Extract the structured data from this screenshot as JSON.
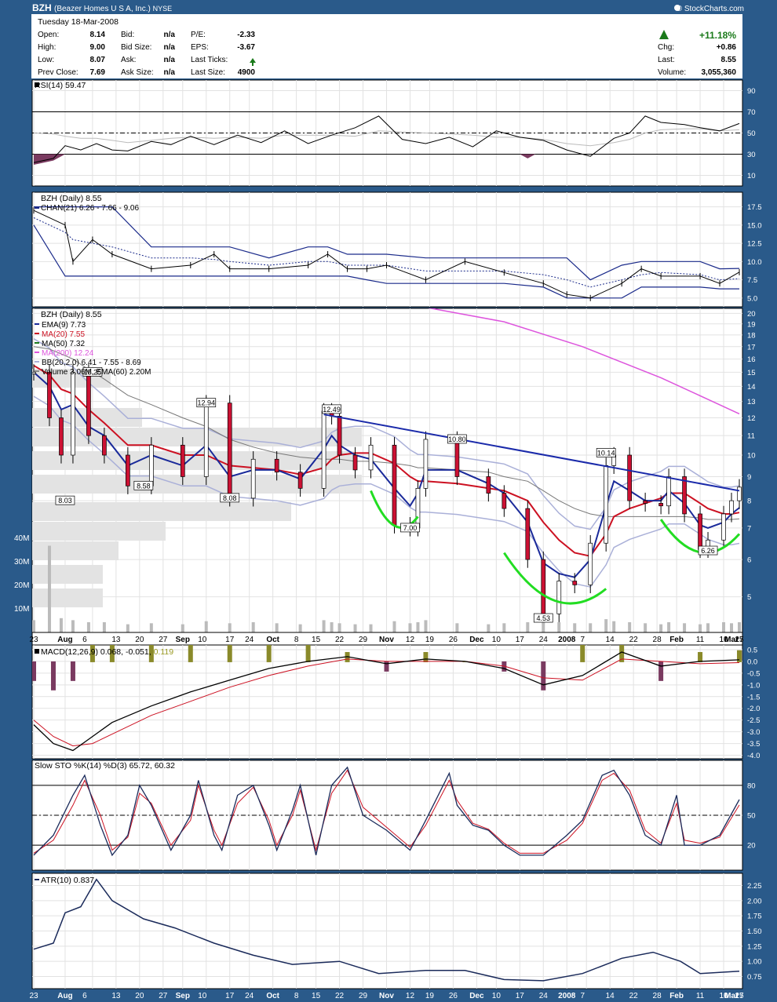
{
  "header": {
    "symbol": "BZH",
    "company": "(Beazer Homes U S A, Inc.)",
    "exchange": "NYSE",
    "credit": "© StockCharts.com",
    "date": "Tuesday  18-Mar-2008",
    "fields_left": [
      {
        "label": "Open:",
        "value": "8.14"
      },
      {
        "label": "High:",
        "value": "9.00"
      },
      {
        "label": "Low:",
        "value": "8.07"
      },
      {
        "label": "Prev Close:",
        "value": "7.69"
      }
    ],
    "fields_mid": [
      {
        "label": "Bid:",
        "value": "n/a"
      },
      {
        "label": "Bid Size:",
        "value": "n/a"
      },
      {
        "label": "Ask:",
        "value": "n/a"
      },
      {
        "label": "Ask Size:",
        "value": "n/a"
      }
    ],
    "fields_pe": [
      {
        "label": "P/E:",
        "value": "-2.33"
      },
      {
        "label": "EPS:",
        "value": "-3.67"
      },
      {
        "label": "Last Ticks:",
        "value": ""
      },
      {
        "label": "Last Size:",
        "value": "4900"
      }
    ],
    "change_pct": "+11.18%",
    "fields_right": [
      {
        "label": "Chg:",
        "value": "+0.86"
      },
      {
        "label": "Last:",
        "value": "8.55"
      },
      {
        "label": "Volume:",
        "value": "3,055,360"
      }
    ]
  },
  "colors": {
    "up": "#1a7a1a",
    "candle_down": "#cc1133",
    "ema9": "#1a2a9a",
    "ma20": "#cc1122",
    "ma50": "#1a7a1a",
    "ma200": "#dd55dd",
    "band": "#aab0d8",
    "trend": "#1a2aaa",
    "cup": "#22dd22",
    "volume": "#bbbbbb"
  },
  "chart_data": [
    {
      "panel": "rsi",
      "type": "line",
      "title": "RSI(14) 59.47",
      "yticks": [
        10,
        30,
        50,
        70,
        90
      ],
      "ylim": [
        0,
        100
      ],
      "x": [
        0,
        5,
        8,
        12,
        16,
        20,
        24,
        30,
        35,
        40,
        46,
        52,
        58,
        64,
        70,
        76,
        82,
        88,
        94,
        100,
        106,
        112,
        118,
        124,
        130,
        136,
        142,
        148,
        152,
        156,
        160,
        166,
        170,
        175,
        180
      ],
      "values": [
        22,
        26,
        38,
        34,
        40,
        34,
        33,
        42,
        39,
        47,
        39,
        48,
        41,
        52,
        40,
        48,
        55,
        66,
        44,
        40,
        46,
        37,
        52,
        46,
        43,
        34,
        28,
        45,
        50,
        66,
        60,
        58,
        55,
        52,
        59
      ],
      "secondary_values": [
        50,
        49,
        47,
        45,
        45,
        43,
        41,
        43,
        45,
        46,
        45,
        46,
        45,
        48,
        48,
        48,
        47,
        52,
        51,
        50,
        49,
        48,
        46,
        46,
        44,
        40,
        38,
        41,
        44,
        50,
        53,
        54,
        54,
        52,
        53
      ]
    },
    {
      "panel": "channel",
      "type": "line",
      "title": "BZH (Daily) 8.55",
      "legend": [
        "CHAN(21) 6.26 - 7.66 - 9.06"
      ],
      "yticks": [
        5.0,
        7.5,
        10.0,
        12.5,
        15.0,
        17.5
      ],
      "ylim": [
        3.8,
        19.5
      ],
      "x": [
        0,
        8,
        10,
        15,
        20,
        30,
        40,
        46,
        50,
        60,
        70,
        75,
        80,
        85,
        90,
        100,
        110,
        120,
        130,
        136,
        142,
        150,
        155,
        160,
        170,
        175,
        180
      ],
      "values": [
        17,
        15,
        10,
        13,
        11,
        9,
        9.5,
        11,
        9,
        9,
        9.5,
        11,
        9,
        9,
        9.5,
        7.5,
        10,
        8.5,
        7,
        5.5,
        5,
        7,
        9,
        8,
        8,
        7,
        8.55
      ],
      "upper": [
        17.5,
        17.5,
        17.5,
        17.5,
        17.5,
        12,
        12,
        12,
        12,
        10.5,
        12,
        12,
        11,
        11,
        11,
        10.5,
        10.5,
        10.5,
        10.5,
        10.5,
        7.5,
        9.5,
        10,
        10,
        10,
        9,
        9.06
      ],
      "middle": [
        16,
        14,
        13,
        12.5,
        12,
        10.5,
        10.5,
        10.3,
        10,
        9.5,
        10,
        10,
        9.5,
        9.5,
        9.5,
        8.7,
        8.7,
        8.7,
        8.2,
        7.5,
        6.5,
        7.5,
        8.2,
        8.5,
        8.2,
        7.5,
        7.66
      ],
      "lower": [
        15,
        8,
        8,
        8,
        8,
        8,
        8,
        8,
        8,
        8,
        8,
        8,
        8,
        7.5,
        7,
        7,
        7,
        7,
        6.5,
        5,
        5,
        5,
        6.5,
        6.5,
        6.5,
        6.26,
        6.26
      ]
    },
    {
      "panel": "price",
      "type": "line",
      "title": "BZH (Daily) 8.55",
      "legend": [
        "EMA(9) 7.73",
        "MA(20) 7.55",
        "MA(50) 7.32",
        "MA(200) 12.24",
        "BB(20,2.0) 6.41 - 7.55 - 8.69",
        "Volume 3.06M, EMA(60) 2.20M"
      ],
      "yticks": [
        5,
        6,
        7,
        8,
        9,
        10,
        11,
        12,
        13,
        14,
        15,
        16,
        17,
        18,
        19,
        20
      ],
      "vol_ticks": [
        "10M",
        "20M",
        "30M",
        "40M"
      ],
      "ylim": [
        4.2,
        20.5
      ],
      "x": [
        0,
        4,
        7,
        10,
        14,
        18,
        24,
        30,
        38,
        44,
        50,
        56,
        62,
        68,
        74,
        76,
        78,
        82,
        86,
        92,
        96,
        98,
        100,
        108,
        116,
        120,
        126,
        130,
        134,
        138,
        142,
        146,
        148,
        152,
        156,
        160,
        162,
        166,
        170,
        172,
        176,
        178,
        180
      ],
      "values": [
        15,
        12,
        10,
        15,
        11,
        10,
        8.6,
        10.5,
        9,
        12.9,
        8.1,
        9.8,
        9.2,
        8.5,
        12.4,
        12.1,
        10,
        9.3,
        10.5,
        7.1,
        7,
        8.5,
        10.8,
        9,
        8.3,
        7.7,
        6,
        4.6,
        5.4,
        5.3,
        6.5,
        9.5,
        10,
        8,
        7.9,
        7.8,
        9,
        7.5,
        6.3,
        6.6,
        7.5,
        8,
        8.55
      ],
      "ema9": [
        15,
        14,
        12.5,
        12.8,
        11.5,
        11,
        9.5,
        10,
        9.5,
        10.5,
        9,
        9.3,
        9.3,
        8.9,
        10.3,
        11,
        10.5,
        10,
        9.8,
        8.5,
        7.8,
        8.3,
        9.3,
        9.3,
        8.7,
        8.3,
        7.2,
        5.9,
        5.6,
        5.5,
        6.0,
        7.8,
        8.8,
        8.4,
        8.0,
        8.0,
        8.4,
        7.9,
        7.1,
        7.0,
        7.2,
        7.5,
        7.73
      ],
      "ma20": [
        15.5,
        14.8,
        13.8,
        13.5,
        12.5,
        11.7,
        10.5,
        10.5,
        10,
        10,
        9.5,
        9.4,
        9.3,
        9.1,
        9.4,
        9.8,
        10,
        10.1,
        10.1,
        9.6,
        9.0,
        8.8,
        8.8,
        8.7,
        8.5,
        8.4,
        8.0,
        7.2,
        6.6,
        6.2,
        6.1,
        6.8,
        7.4,
        7.7,
        7.9,
        8.1,
        8.3,
        8.3,
        7.9,
        7.7,
        7.5,
        7.5,
        7.55
      ],
      "ma50": [
        17,
        16.8,
        16.4,
        16,
        15.2,
        14.5,
        13.4,
        12.8,
        12,
        11.5,
        10.8,
        10.4,
        10.1,
        9.9,
        9.8,
        9.8,
        9.8,
        9.7,
        9.7,
        9.6,
        9.5,
        9.4,
        9.4,
        9.3,
        9.2,
        9.0,
        8.8,
        8.4,
        8.0,
        7.7,
        7.5,
        7.4,
        7.4,
        7.4,
        7.4,
        7.4,
        7.4,
        7.4,
        7.35,
        7.3,
        7.3,
        7.3,
        7.32
      ],
      "ma200_x": [
        100,
        120,
        140,
        160,
        180
      ],
      "ma200": [
        20.6,
        19.2,
        17,
        14.6,
        12.24
      ],
      "volume_pct": [
        12,
        85,
        14,
        12,
        10,
        10,
        8,
        9,
        8,
        11,
        9,
        10,
        9,
        8,
        12,
        10,
        9,
        8,
        8,
        11,
        9,
        10,
        12,
        9,
        8,
        9,
        10,
        11,
        10,
        9,
        9,
        13,
        11,
        10,
        9,
        8,
        10,
        9,
        8,
        9,
        10,
        9,
        10
      ],
      "annotations": [
        {
          "x": 15,
          "y": 15,
          "label": "15.25"
        },
        {
          "x": 8,
          "y": 8,
          "label": "8.03"
        },
        {
          "x": 28,
          "y": 8.6,
          "label": "8.58"
        },
        {
          "x": 44,
          "y": 12.9,
          "label": "12.94"
        },
        {
          "x": 50,
          "y": 8.1,
          "label": "8.08"
        },
        {
          "x": 76,
          "y": 12.5,
          "label": "12.49"
        },
        {
          "x": 96,
          "y": 7,
          "label": "7.00"
        },
        {
          "x": 108,
          "y": 10.8,
          "label": "10.80"
        },
        {
          "x": 130,
          "y": 4.5,
          "label": "4.53"
        },
        {
          "x": 146,
          "y": 10.1,
          "label": "10.14"
        },
        {
          "x": 172,
          "y": 6.26,
          "label": "6.26"
        }
      ],
      "trendline": {
        "x": [
          74,
          180
        ],
        "y": [
          12.2,
          8.4
        ]
      }
    },
    {
      "panel": "macd",
      "type": "line",
      "title_main": "MACD(12,26,9) 0.068, -0.051,",
      "title_hist": "0.119",
      "yticks": [
        0.5,
        0.0,
        -0.5,
        -1.0,
        -1.5,
        -2.0,
        -2.5,
        -3.0,
        -3.5,
        -4.0
      ],
      "ylim": [
        -4.15,
        0.7
      ],
      "x": [
        0,
        5,
        10,
        15,
        20,
        30,
        40,
        50,
        60,
        70,
        80,
        90,
        100,
        110,
        120,
        130,
        140,
        150,
        160,
        170,
        180
      ],
      "values": [
        -2.7,
        -3.5,
        -3.8,
        -3.2,
        -2.6,
        -1.9,
        -1.3,
        -0.8,
        -0.3,
        0.0,
        0.2,
        -0.1,
        0.1,
        0.0,
        -0.3,
        -1.0,
        -0.6,
        0.4,
        -0.2,
        0.0,
        0.068
      ],
      "signal": [
        -2.5,
        -3.2,
        -3.6,
        -3.5,
        -3.1,
        -2.3,
        -1.7,
        -1.1,
        -0.6,
        -0.2,
        0.1,
        0.0,
        0.0,
        0.0,
        -0.2,
        -0.7,
        -0.8,
        0.1,
        0.0,
        -0.1,
        -0.051
      ]
    },
    {
      "panel": "stoch",
      "type": "line",
      "title": "Slow STO %K(14) %D(3) 65.72, 60.32",
      "yticks": [
        20,
        50,
        80
      ],
      "ylim": [
        -5,
        105
      ],
      "x": [
        0,
        5,
        10,
        13,
        17,
        20,
        24,
        27,
        30,
        35,
        40,
        42,
        46,
        48,
        52,
        56,
        60,
        62,
        66,
        68,
        72,
        76,
        80,
        84,
        90,
        96,
        100,
        106,
        108,
        112,
        116,
        120,
        124,
        130,
        136,
        140,
        145,
        148,
        152,
        156,
        160,
        164,
        166,
        170,
        175,
        180
      ],
      "values": [
        10,
        30,
        70,
        90,
        40,
        10,
        30,
        80,
        60,
        15,
        50,
        85,
        30,
        15,
        70,
        80,
        40,
        15,
        55,
        80,
        10,
        80,
        98,
        50,
        35,
        15,
        45,
        92,
        60,
        40,
        35,
        20,
        10,
        10,
        30,
        45,
        90,
        95,
        70,
        30,
        20,
        70,
        20,
        20,
        30,
        65.72
      ],
      "secondary_values": [
        12,
        25,
        60,
        85,
        50,
        15,
        28,
        72,
        62,
        20,
        45,
        80,
        35,
        20,
        62,
        78,
        45,
        20,
        50,
        75,
        15,
        72,
        95,
        58,
        38,
        18,
        40,
        85,
        65,
        42,
        36,
        22,
        12,
        12,
        25,
        42,
        85,
        92,
        75,
        35,
        22,
        62,
        25,
        22,
        28,
        60.32
      ]
    },
    {
      "panel": "atr",
      "type": "line",
      "title": "ATR(10) 0.837",
      "yticks": [
        0.75,
        1.0,
        1.25,
        1.5,
        1.75,
        2.0,
        2.25
      ],
      "ylim": [
        0.55,
        2.45
      ],
      "x": [
        0,
        5,
        8,
        12,
        16,
        20,
        28,
        36,
        46,
        56,
        66,
        78,
        88,
        100,
        110,
        120,
        130,
        140,
        150,
        158,
        165,
        170,
        180
      ],
      "values": [
        1.2,
        1.3,
        1.8,
        1.9,
        2.35,
        2.0,
        1.7,
        1.55,
        1.3,
        1.1,
        0.95,
        1.0,
        0.8,
        0.85,
        0.85,
        0.7,
        0.68,
        0.8,
        1.05,
        1.15,
        1.0,
        0.8,
        0.837
      ]
    }
  ],
  "x_axis_labels": [
    "23",
    "Aug",
    "6",
    "13",
    "20",
    "27",
    "Sep",
    "10",
    "17",
    "24",
    "Oct",
    "8",
    "15",
    "22",
    "29",
    "Nov",
    "12",
    "19",
    "26",
    "Dec",
    "10",
    "17",
    "24",
    "2008",
    "7",
    "14",
    "22",
    "28",
    "Feb",
    "11",
    "19",
    "25",
    "Mar",
    "10",
    "17"
  ]
}
